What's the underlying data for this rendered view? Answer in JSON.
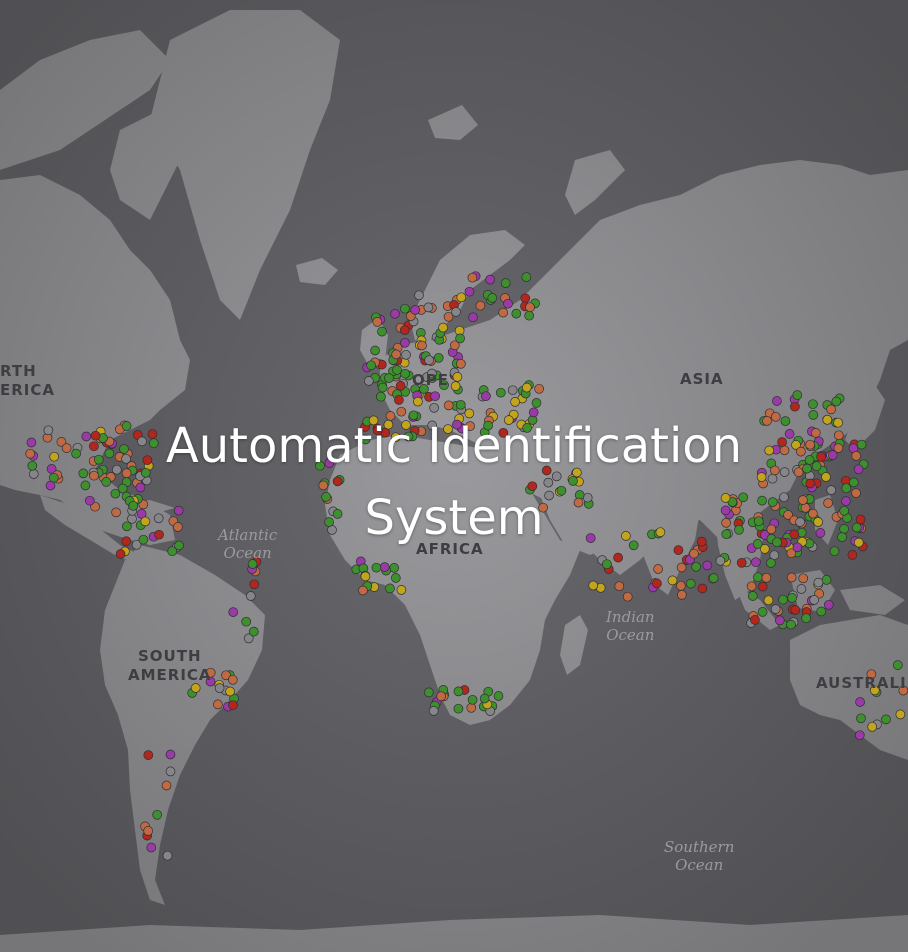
{
  "title": "Automatic Identification\nSystem",
  "map": {
    "land_color": "#a4a4a8",
    "water_color": "#6f6f74",
    "continent_labels": {
      "north_america": "RTH\nERICA",
      "europe": "OPE",
      "asia": "ASIA",
      "africa": "AFRICA",
      "south_america": "SOUTH\nAMERICA",
      "australia": "AUSTRALI"
    },
    "ocean_labels": {
      "atlantic": "Atlantic\nOcean",
      "indian": "Indian\nOcean",
      "southern": "Southern\nOcean"
    },
    "marker_colors": {
      "green": "#3e8f2e",
      "orange": "#c06a43",
      "purple": "#9a3aa6",
      "yellow": "#c3a51d",
      "red": "#b1271e",
      "gray": "#85858a"
    }
  }
}
